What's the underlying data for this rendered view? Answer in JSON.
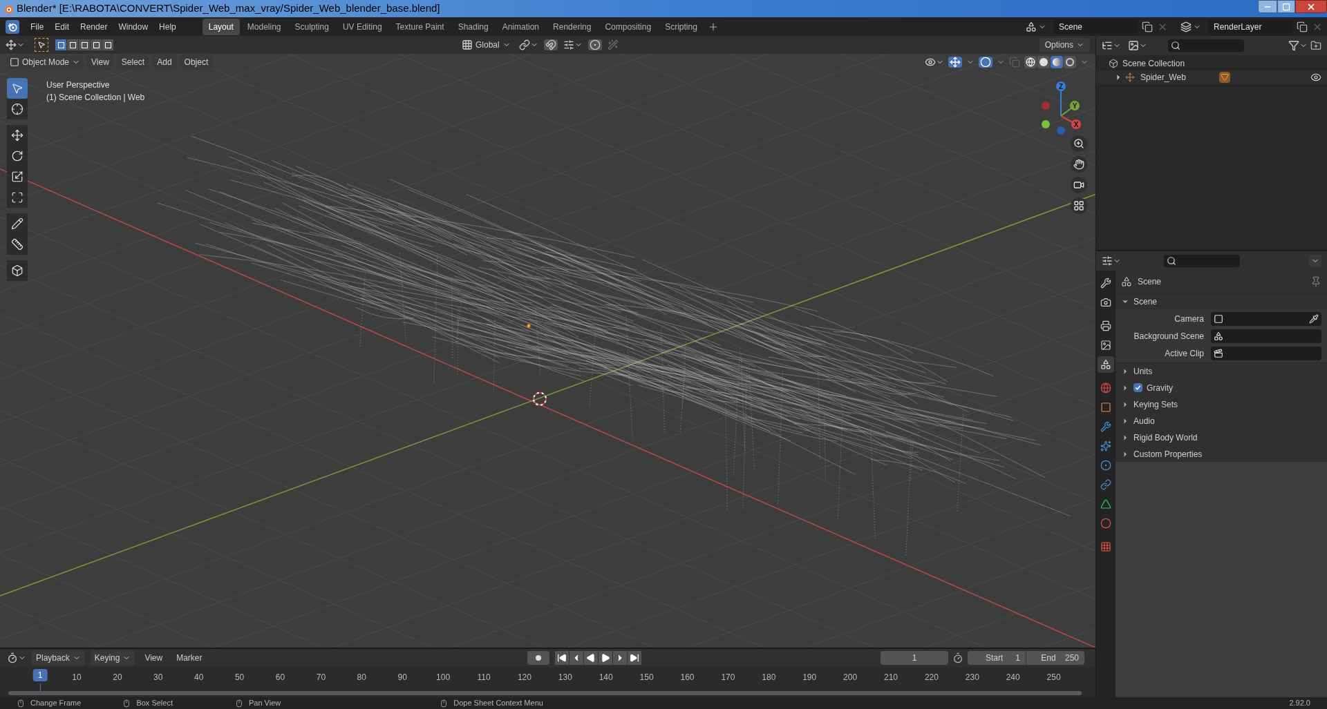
{
  "window": {
    "title": "Blender* [E:\\RABOTA\\CONVERT\\Spider_Web_max_vray/Spider_Web_blender_base.blend]"
  },
  "menu": [
    "File",
    "Edit",
    "Render",
    "Window",
    "Help"
  ],
  "workspaces": [
    {
      "label": "Layout",
      "selected": true
    },
    {
      "label": "Modeling",
      "selected": false
    },
    {
      "label": "Sculpting",
      "selected": false
    },
    {
      "label": "UV Editing",
      "selected": false
    },
    {
      "label": "Texture Paint",
      "selected": false
    },
    {
      "label": "Shading",
      "selected": false
    },
    {
      "label": "Animation",
      "selected": false
    },
    {
      "label": "Rendering",
      "selected": false
    },
    {
      "label": "Compositing",
      "selected": false
    },
    {
      "label": "Scripting",
      "selected": false
    }
  ],
  "scene": "Scene",
  "view_layer": "RenderLayer",
  "viewport": {
    "orientation": "Global",
    "options": "Options",
    "mode": "Object Mode",
    "menus": [
      "View",
      "Select",
      "Add",
      "Object"
    ],
    "info": [
      "User Perspective",
      "(1) Scene Collection | Web"
    ],
    "gizmo": [
      "Z",
      "Y",
      "X"
    ],
    "select_modes": [
      {
        "selected": true
      },
      {
        "selected": false
      },
      {
        "selected": false
      },
      {
        "selected": false
      },
      {
        "selected": false
      }
    ],
    "shading": [
      {
        "kind": "wireframe",
        "selected": false
      },
      {
        "kind": "solid",
        "selected": false
      },
      {
        "kind": "material",
        "selected": true
      },
      {
        "kind": "rendered",
        "selected": false
      }
    ],
    "tools": [
      {
        "kind": "select",
        "selected": true
      },
      {
        "kind": "cursor",
        "selected": false
      },
      {
        "kind": "move",
        "selected": false
      },
      {
        "kind": "rotate",
        "selected": false
      },
      {
        "kind": "scale",
        "selected": false
      },
      {
        "kind": "transform",
        "selected": false
      },
      {
        "kind": "annotate",
        "selected": false
      },
      {
        "kind": "measure",
        "selected": false
      },
      {
        "kind": "add_cube",
        "selected": false
      }
    ]
  },
  "outliner": {
    "title": "Scene Collection",
    "items": [
      {
        "label": "Spider_Web",
        "expanded": false
      }
    ]
  },
  "properties": {
    "tabs": [
      {
        "kind": "tool",
        "selected": false
      },
      {
        "kind": "render",
        "selected": false
      },
      {
        "kind": "output",
        "selected": false
      },
      {
        "kind": "view_layer",
        "selected": false
      },
      {
        "kind": "scene",
        "selected": true
      },
      {
        "kind": "world",
        "selected": false
      },
      {
        "kind": "object",
        "selected": false
      },
      {
        "kind": "modifiers",
        "selected": false
      },
      {
        "kind": "particles",
        "selected": false
      },
      {
        "kind": "physics",
        "selected": false
      },
      {
        "kind": "constraints",
        "selected": false
      },
      {
        "kind": "data",
        "selected": false
      },
      {
        "kind": "material",
        "selected": false
      },
      {
        "kind": "texture",
        "selected": false
      }
    ],
    "context": "Scene",
    "panel": {
      "title": "Scene",
      "expanded": true,
      "fields": [
        {
          "label": "Camera",
          "kind": "camera"
        },
        {
          "label": "Background Scene",
          "kind": "scene"
        },
        {
          "label": "Active Clip",
          "kind": "clip"
        }
      ]
    },
    "sections": [
      {
        "label": "Units",
        "kind": "plain",
        "expanded": false
      },
      {
        "label": "Gravity",
        "kind": "checkbox",
        "checked": true,
        "expanded": false
      },
      {
        "label": "Keying Sets",
        "kind": "plain",
        "expanded": false
      },
      {
        "label": "Audio",
        "kind": "plain",
        "expanded": false
      },
      {
        "label": "Rigid Body World",
        "kind": "plain",
        "expanded": false
      },
      {
        "label": "Custom Properties",
        "kind": "plain",
        "expanded": false
      }
    ]
  },
  "timeline": {
    "menus": [
      "Playback",
      "Keying",
      "View",
      "Marker"
    ],
    "current_frame": "1",
    "start_label": "Start",
    "start": "1",
    "end_label": "End",
    "end": "250",
    "marker": "1",
    "ruler": [
      "10",
      "20",
      "30",
      "40",
      "50",
      "60",
      "70",
      "80",
      "90",
      "100",
      "110",
      "120",
      "130",
      "140",
      "150",
      "160",
      "170",
      "180",
      "190",
      "200",
      "210",
      "220",
      "230",
      "240",
      "250"
    ]
  },
  "status_bar": {
    "hints": [
      "Change Frame",
      "Box Select",
      "Pan View",
      "Dope Sheet Context Menu"
    ],
    "version": "2.92.0"
  }
}
